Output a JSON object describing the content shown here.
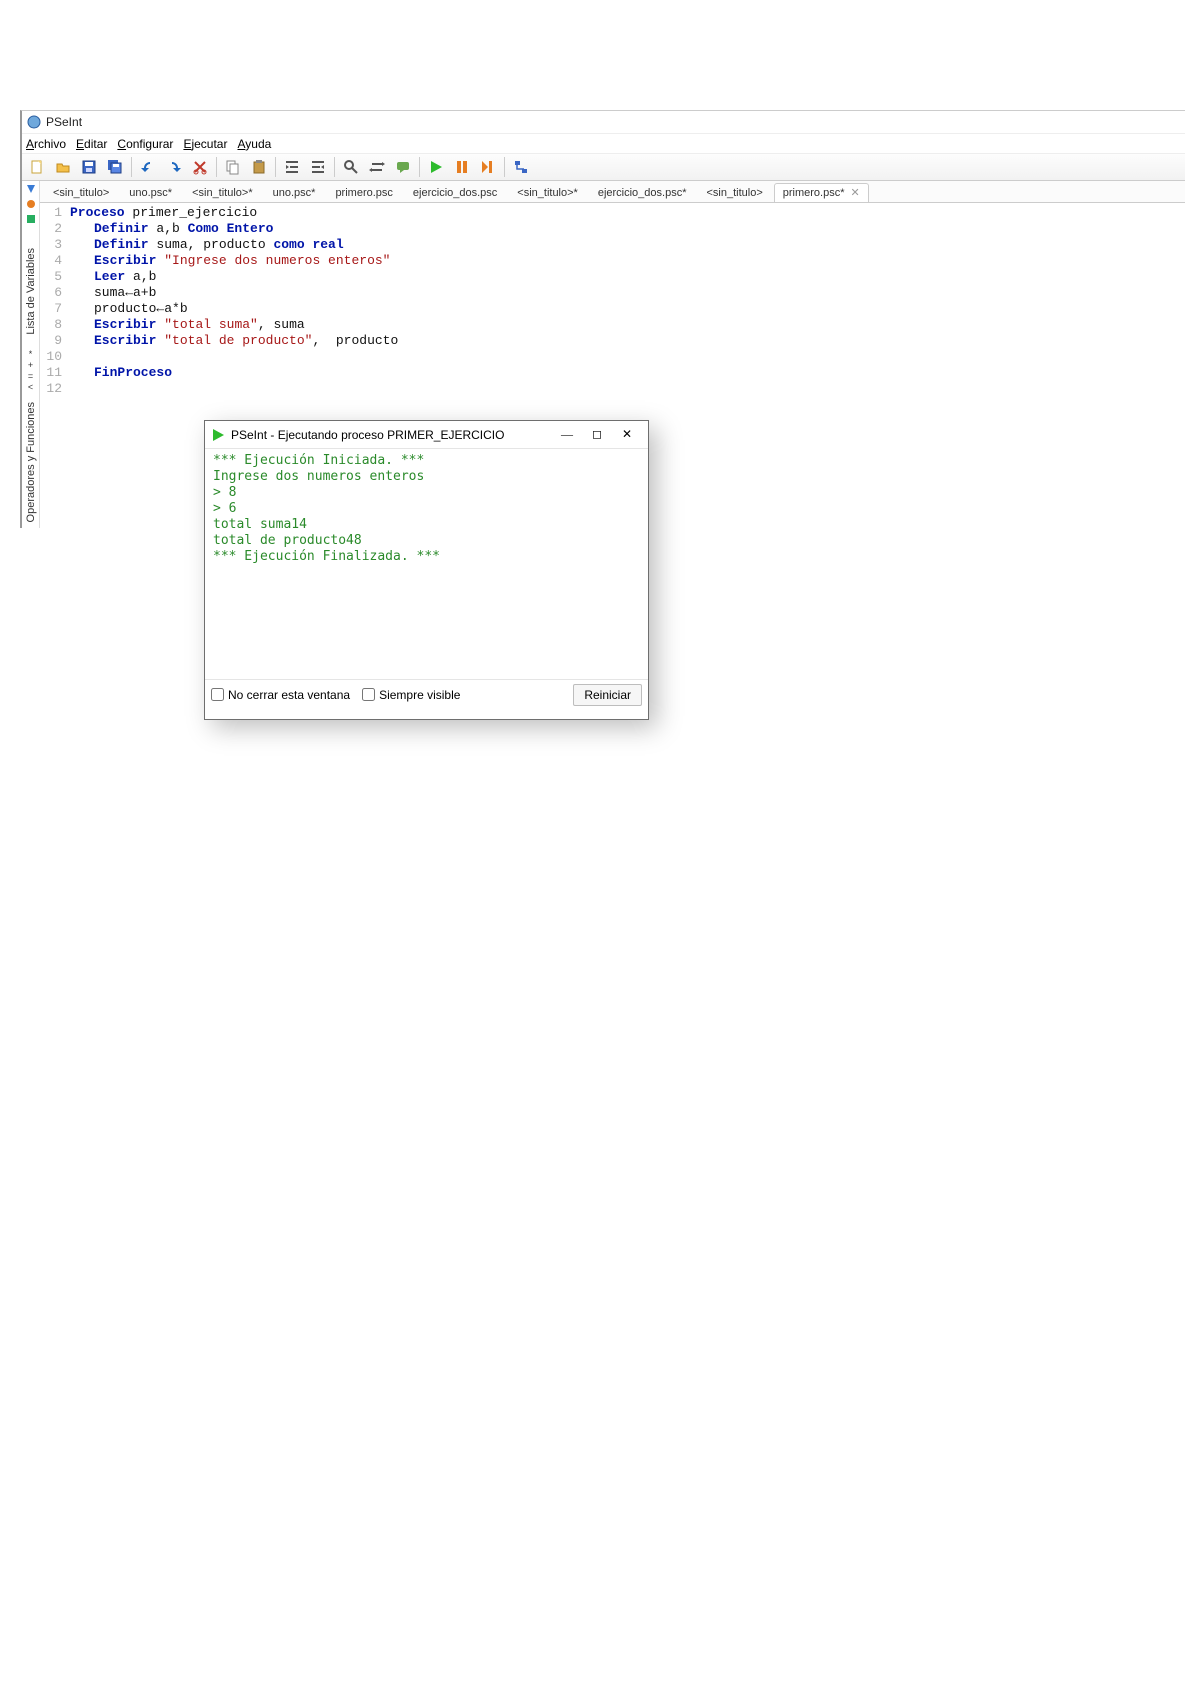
{
  "app_title": "PSeInt",
  "menu": {
    "items": [
      "Archivo",
      "Editar",
      "Configurar",
      "Ejecutar",
      "Ayuda"
    ]
  },
  "toolbar": {
    "icons": [
      "new-file-icon",
      "open-file-icon",
      "save-icon",
      "save-all-icon",
      "sep",
      "undo-icon",
      "redo-icon",
      "cut-icon",
      "sep",
      "copy-icon",
      "paste-icon",
      "sep",
      "indent-icon",
      "outdent-icon",
      "sep",
      "find-icon",
      "replace-icon",
      "comment-icon",
      "sep",
      "run-icon",
      "pause-icon",
      "step-icon",
      "sep",
      "flowchart-icon"
    ]
  },
  "sidetabs": {
    "label1": "Lista de Variables",
    "label2": "Operadores y Funciones"
  },
  "tabs": [
    {
      "label": "<sin_titulo>",
      "active": false
    },
    {
      "label": "uno.psc*",
      "active": false
    },
    {
      "label": "<sin_titulo>*",
      "active": false
    },
    {
      "label": "uno.psc*",
      "active": false
    },
    {
      "label": "primero.psc",
      "active": false
    },
    {
      "label": "ejercicio_dos.psc",
      "active": false
    },
    {
      "label": "<sin_titulo>*",
      "active": false
    },
    {
      "label": "ejercicio_dos.psc*",
      "active": false
    },
    {
      "label": "<sin_titulo>",
      "active": false
    },
    {
      "label": "primero.psc*",
      "active": true,
      "closable": true
    }
  ],
  "code": {
    "close_x": "✕",
    "lines": [
      {
        "n": "1",
        "indent": 0,
        "tokens": [
          {
            "t": "Proceso",
            "c": "kw"
          },
          {
            "t": " primer_ejercicio",
            "c": "ident"
          }
        ]
      },
      {
        "n": "2",
        "indent": 1,
        "tokens": [
          {
            "t": "Definir",
            "c": "kw"
          },
          {
            "t": " a,b ",
            "c": "ident"
          },
          {
            "t": "Como Entero",
            "c": "kw"
          }
        ]
      },
      {
        "n": "3",
        "indent": 1,
        "tokens": [
          {
            "t": "Definir",
            "c": "kw"
          },
          {
            "t": " suma, producto ",
            "c": "ident"
          },
          {
            "t": "como real",
            "c": "kw"
          }
        ]
      },
      {
        "n": "4",
        "indent": 1,
        "tokens": [
          {
            "t": "Escribir",
            "c": "kw"
          },
          {
            "t": " ",
            "c": "ident"
          },
          {
            "t": "\"Ingrese dos numeros enteros\"",
            "c": "str"
          }
        ]
      },
      {
        "n": "5",
        "indent": 1,
        "tokens": [
          {
            "t": "Leer",
            "c": "kw"
          },
          {
            "t": " a,b",
            "c": "ident"
          }
        ]
      },
      {
        "n": "6",
        "indent": 1,
        "tokens": [
          {
            "t": "suma←a+b",
            "c": "ident"
          }
        ]
      },
      {
        "n": "7",
        "indent": 1,
        "tokens": [
          {
            "t": "producto←a*b",
            "c": "ident"
          }
        ]
      },
      {
        "n": "8",
        "indent": 1,
        "tokens": [
          {
            "t": "Escribir",
            "c": "kw"
          },
          {
            "t": " ",
            "c": "ident"
          },
          {
            "t": "\"total suma\"",
            "c": "str"
          },
          {
            "t": ", suma",
            "c": "ident"
          }
        ]
      },
      {
        "n": "9",
        "indent": 1,
        "tokens": [
          {
            "t": "Escribir",
            "c": "kw"
          },
          {
            "t": " ",
            "c": "ident"
          },
          {
            "t": "\"total de producto\"",
            "c": "str"
          },
          {
            "t": ",  producto",
            "c": "ident"
          }
        ]
      },
      {
        "n": "10",
        "indent": 0,
        "tokens": []
      },
      {
        "n": "11",
        "indent": 1,
        "tokens": [
          {
            "t": "FinProceso",
            "c": "kw"
          }
        ]
      },
      {
        "n": "12",
        "indent": 0,
        "tokens": []
      }
    ]
  },
  "console": {
    "title": "PSeInt - Ejecutando proceso PRIMER_EJERCICIO",
    "lines": [
      "*** Ejecución Iniciada. ***",
      "Ingrese dos numeros enteros",
      "> 8",
      "> 6",
      "total suma14",
      "total de producto48",
      "*** Ejecución Finalizada. ***"
    ],
    "chk_noclose": "No cerrar esta ventana",
    "chk_always": "Siempre visible",
    "btn_restart": "Reiniciar",
    "winctrl": {
      "min": "—",
      "max": "◻",
      "close": "✕"
    }
  }
}
